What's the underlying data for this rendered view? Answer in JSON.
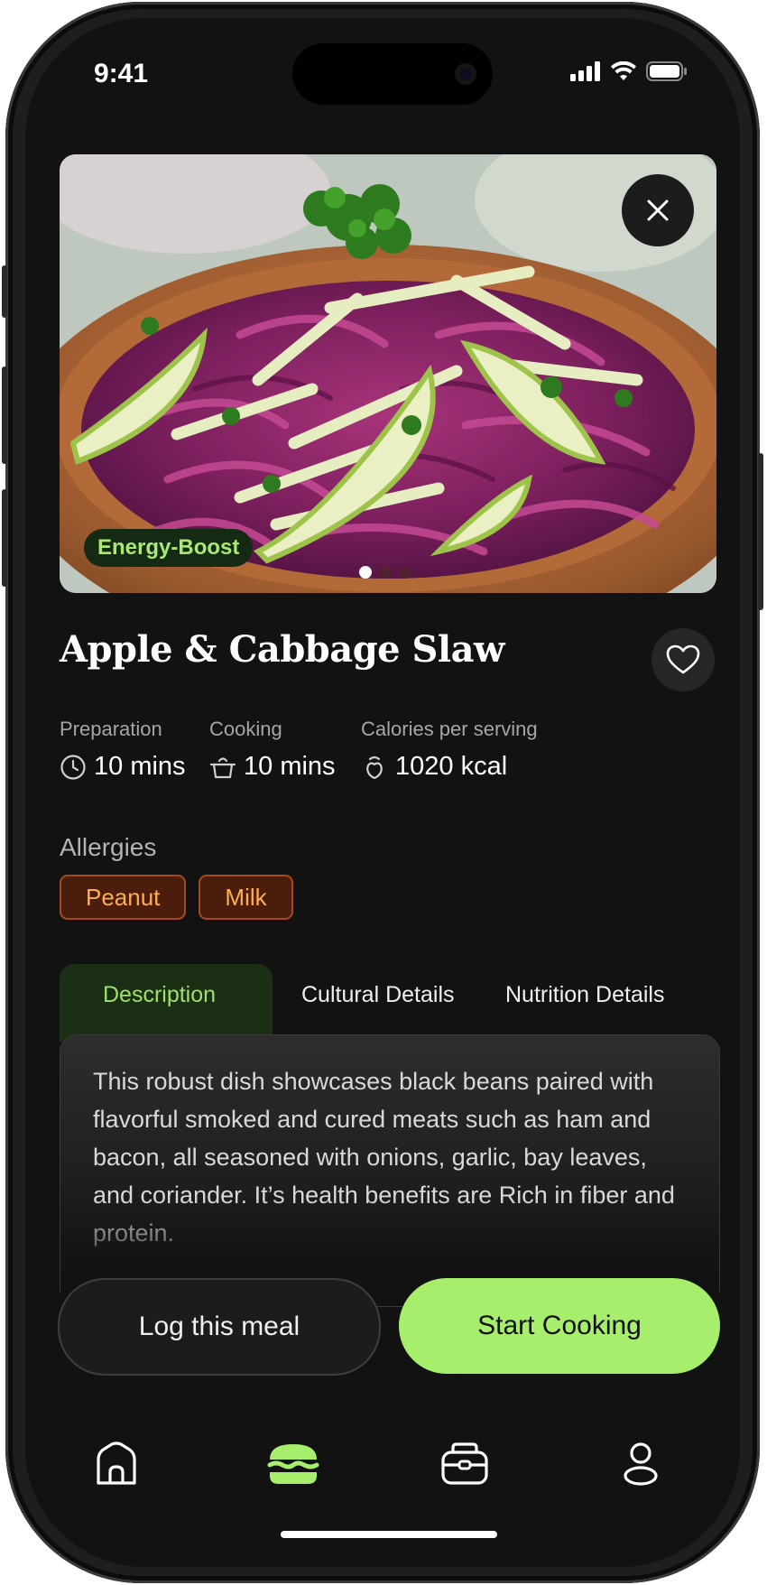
{
  "status_bar": {
    "time": "9:41"
  },
  "hero": {
    "image_alt": "Apple & Cabbage Slaw in a wooden bowl",
    "tag": "Energy-Boost",
    "page_count": 3,
    "active_page": 1,
    "close_icon": "close-icon"
  },
  "recipe": {
    "title": "Apple & Cabbage Slaw",
    "favorite_icon": "heart-icon",
    "stats": [
      {
        "label": "Preparation",
        "value": "10 mins",
        "icon": "clock-icon"
      },
      {
        "label": "Cooking",
        "value": "10 mins",
        "icon": "pot-icon"
      },
      {
        "label": "Calories per serving",
        "value": "1020 kcal",
        "icon": "calorie-icon"
      }
    ]
  },
  "allergies": {
    "label": "Allergies",
    "items": [
      "Peanut",
      "Milk"
    ]
  },
  "tabs": [
    {
      "label": "Description",
      "active": true
    },
    {
      "label": "Cultural Details",
      "active": false
    },
    {
      "label": "Nutrition Details",
      "active": false
    }
  ],
  "description": "This robust dish showcases black beans paired with flavorful smoked and cured meats such as ham and bacon, all seasoned with onions, garlic, bay leaves, and coriander. It’s health benefits are Rich in fiber and protein.",
  "actions": {
    "log_label": "Log this meal",
    "start_label": "Start Cooking"
  },
  "nav": [
    {
      "icon": "home-icon",
      "active": false
    },
    {
      "icon": "burger-icon",
      "active": true
    },
    {
      "icon": "lunchbox-icon",
      "active": false
    },
    {
      "icon": "profile-icon",
      "active": false
    }
  ],
  "colors": {
    "background": "#121212",
    "accent": "#a6ee6c",
    "tag_bg": "#142a12",
    "allergy_bg": "#4a1d0d",
    "allergy_text": "#ffad52"
  }
}
